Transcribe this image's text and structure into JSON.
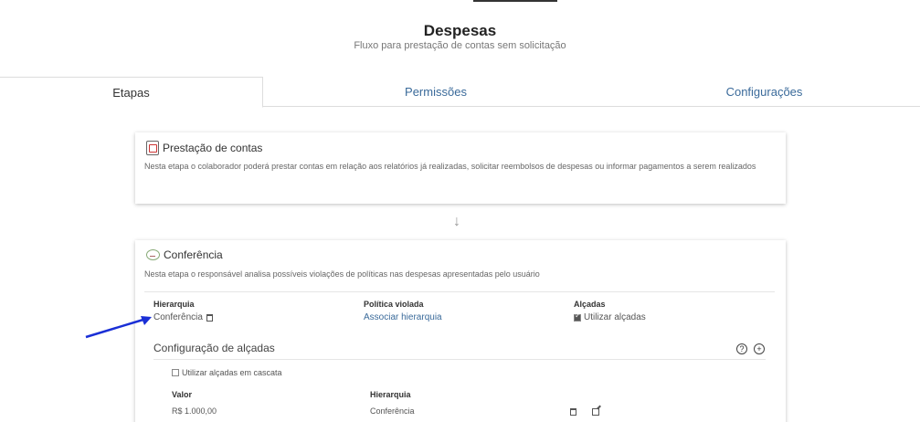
{
  "header": {
    "title": "Despesas",
    "subtitle": "Fluxo para prestação de contas sem solicitação"
  },
  "tabs": [
    {
      "label": "Etapas",
      "active": true
    },
    {
      "label": "Permissões",
      "active": false
    },
    {
      "label": "Configurações",
      "active": false
    }
  ],
  "step1": {
    "title": "Prestação de contas",
    "description": "Nesta etapa o colaborador poderá prestar contas em relação aos relatórios já realizadas, solicitar reembolsos de despesas ou informar pagamentos a serem realizados",
    "icon": "document-icon"
  },
  "step2": {
    "title": "Conferência",
    "description": "Nesta etapa o responsável analisa possíveis violações de políticas nas despesas apresentadas pelo usuário",
    "icon": "review-icon",
    "hierarquia_label": "Hierarquia",
    "hierarquia_value": "Conferência",
    "politica_label": "Política violada",
    "politica_link": "Associar hierarquia",
    "alcadas_label": "Alçadas",
    "alcadas_checkbox": "Utilizar alçadas",
    "alcadas_checked": true,
    "config": {
      "title": "Configuração de alçadas",
      "cascade_label": "Utilizar alçadas em cascata",
      "cascade_checked": false,
      "col_valor": "Valor",
      "col_hierarquia": "Hierarquia",
      "rows": [
        {
          "valor": "R$ 1.000,00",
          "hierarquia": "Conferência"
        }
      ]
    }
  },
  "colors": {
    "link": "#3a6a9a",
    "annotation_arrow": "#1a2fd6"
  }
}
